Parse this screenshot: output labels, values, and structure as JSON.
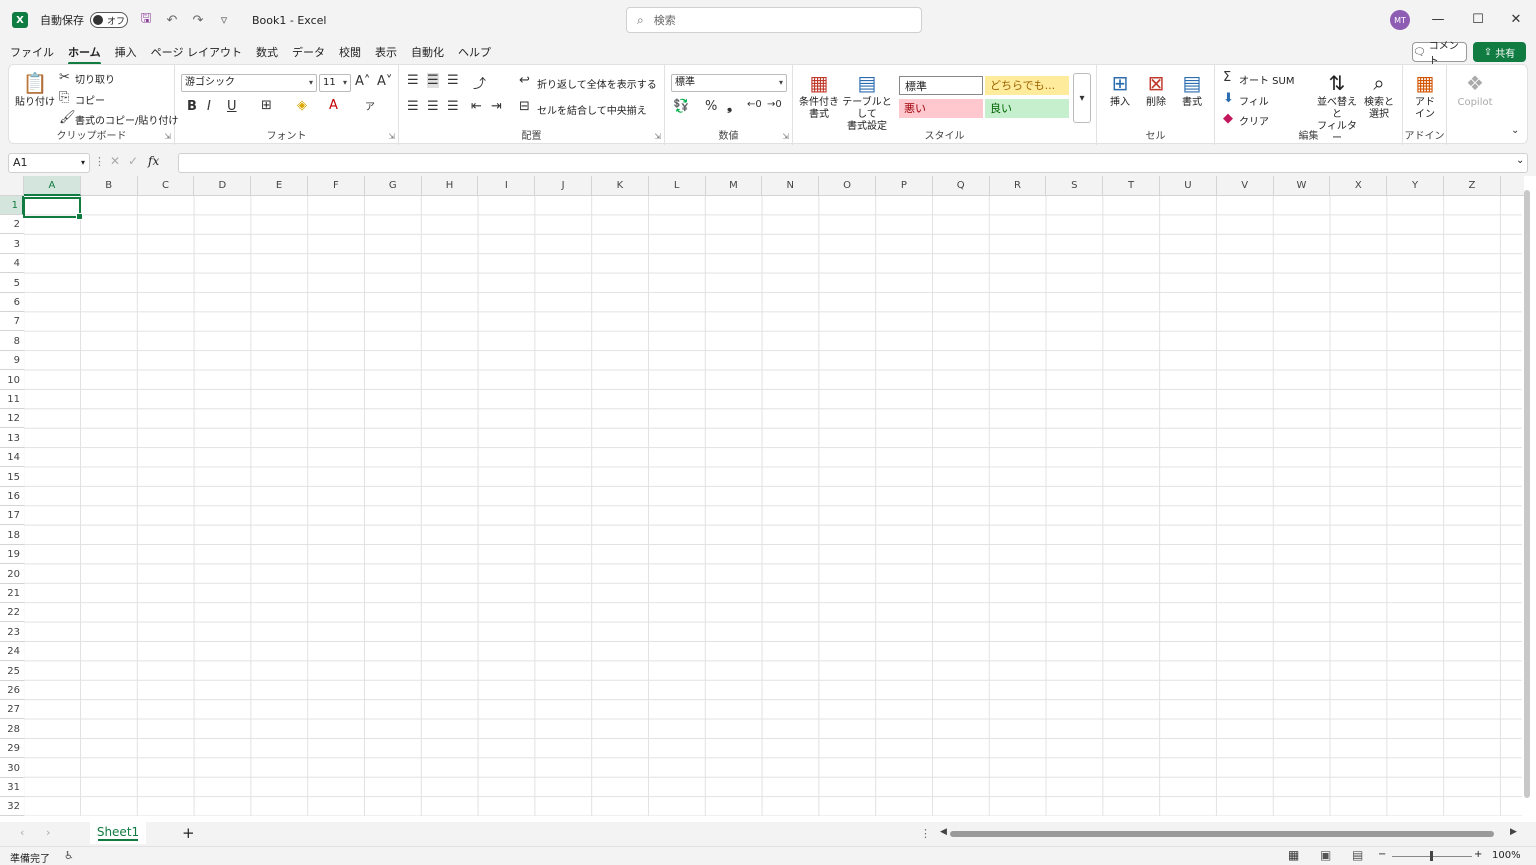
{
  "titlebar": {
    "logo": "X",
    "autosave_label": "自動保存",
    "autosave_state": "オフ",
    "doc_title": "Book1  -  Excel",
    "search_placeholder": "検索",
    "avatar_initials": "MT"
  },
  "menu": {
    "tabs": [
      "ファイル",
      "ホーム",
      "挿入",
      "ページ レイアウト",
      "数式",
      "データ",
      "校閲",
      "表示",
      "自動化",
      "ヘルプ"
    ],
    "active": "ホーム",
    "comment_label": "コメント",
    "share_label": "共有"
  },
  "ribbon": {
    "clipboard": {
      "label": "クリップボード",
      "paste": "貼り付け",
      "cut": "切り取り",
      "copy": "コピー",
      "format_painter": "書式のコピー/貼り付け"
    },
    "font": {
      "label": "フォント",
      "font_name": "游ゴシック",
      "font_size": "11",
      "bold": "B",
      "italic": "I",
      "underline": "U"
    },
    "alignment": {
      "label": "配置",
      "wrap_text": "折り返して全体を表示する",
      "merge_center": "セルを結合して中央揃え"
    },
    "number": {
      "label": "数値",
      "format": "標準",
      "percent": "%",
      "comma": "❟"
    },
    "styles": {
      "label": "スタイル",
      "conditional": [
        "条件付き",
        "書式"
      ],
      "as_table": [
        "テーブルとして",
        "書式設定"
      ],
      "normal": "標準",
      "neutral": "どちらでも...",
      "bad": "悪い",
      "good": "良い",
      "colors": {
        "neutral_bg": "#ffeb9c",
        "neutral_fg": "#9c6500",
        "bad_bg": "#ffc7ce",
        "bad_fg": "#9c0006",
        "good_bg": "#c6efce",
        "good_fg": "#006100"
      }
    },
    "cells": {
      "label": "セル",
      "insert": "挿入",
      "delete": "削除",
      "format": "書式"
    },
    "editing": {
      "label": "編集",
      "autosum": "オート SUM",
      "fill": "フィル",
      "clear": "クリア",
      "sort_filter": [
        "並べ替えと",
        "フィルター"
      ],
      "find_select": [
        "検索と",
        "選択"
      ]
    },
    "addins": {
      "label": "アドイン",
      "addin": [
        "アド",
        "イン"
      ],
      "copilot": "Copilot"
    }
  },
  "formula_bar": {
    "name_box": "A1",
    "fx": "fx",
    "content": ""
  },
  "grid": {
    "columns": [
      "A",
      "B",
      "C",
      "D",
      "E",
      "F",
      "G",
      "H",
      "I",
      "J",
      "K",
      "L",
      "M",
      "N",
      "O",
      "P",
      "Q",
      "R",
      "S",
      "T",
      "U",
      "V",
      "W",
      "X",
      "Y",
      "Z"
    ],
    "rows": [
      "1",
      "2",
      "3",
      "4",
      "5",
      "6",
      "7",
      "8",
      "9",
      "10",
      "11",
      "12",
      "13",
      "14",
      "15",
      "16",
      "17",
      "18",
      "19",
      "20",
      "21",
      "22",
      "23",
      "24",
      "25",
      "26",
      "27",
      "28",
      "29",
      "30",
      "31",
      "32"
    ],
    "active_cell": "A1"
  },
  "sheets": {
    "tabs": [
      "Sheet1"
    ],
    "add": "+"
  },
  "status": {
    "ready": "準備完了",
    "zoom": "100%",
    "zoom_minus": "−",
    "zoom_plus": "+"
  },
  "accent": "#107c41"
}
